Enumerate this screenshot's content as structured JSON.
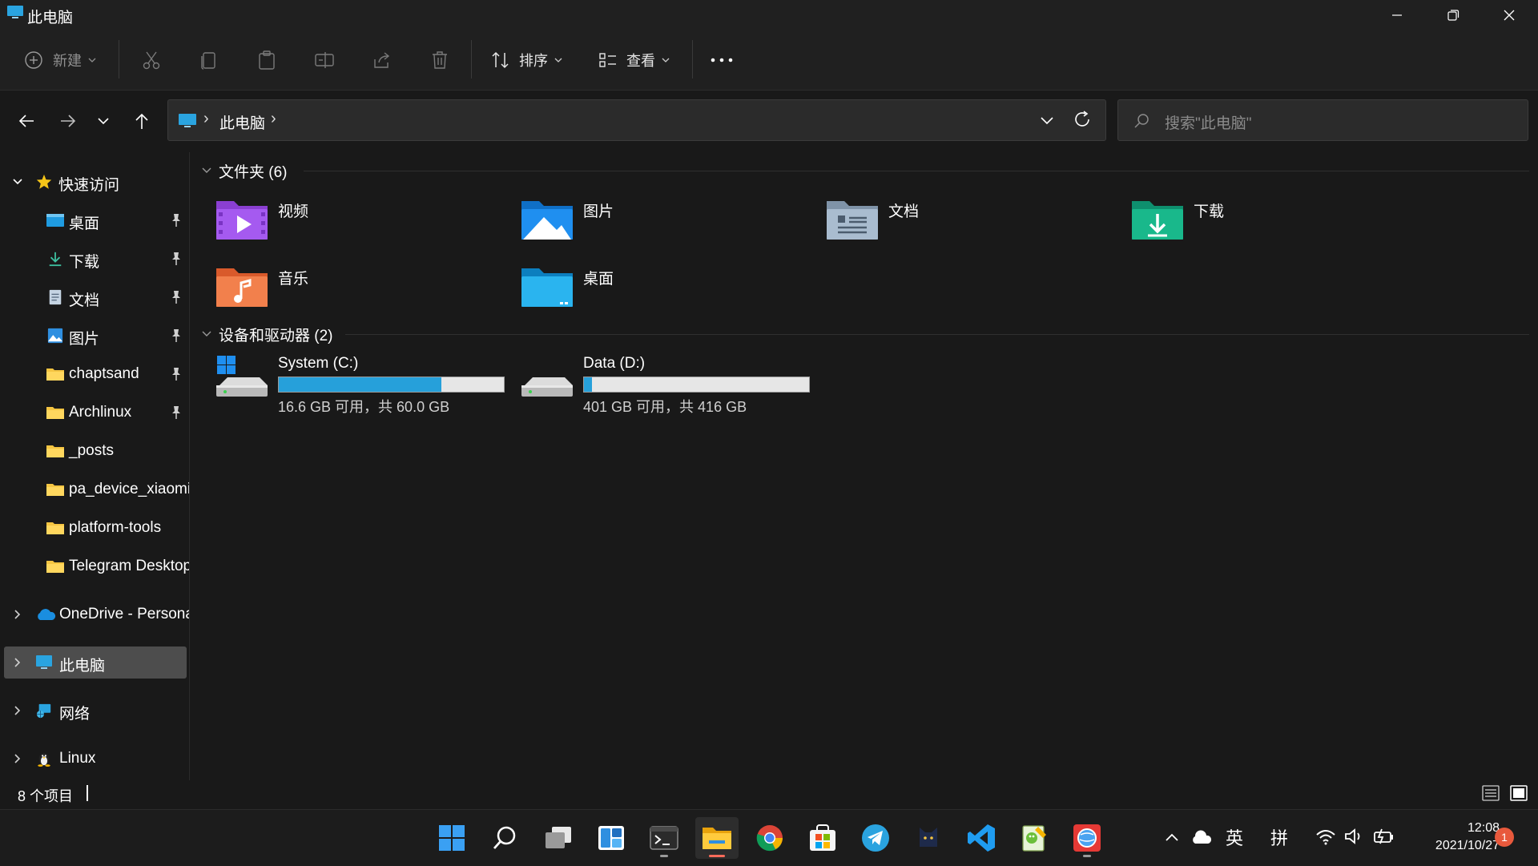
{
  "window": {
    "title": "此电脑"
  },
  "commandbar": {
    "new_label": "新建",
    "sort_label": "排序",
    "view_label": "查看"
  },
  "address": {
    "crumb": "此电脑",
    "search_placeholder": "搜索\"此电脑\""
  },
  "sidebar": {
    "quick_access": "快速访问",
    "items": [
      {
        "label": "桌面",
        "icon": "desktop-folder-icon",
        "pinned": true
      },
      {
        "label": "下载",
        "icon": "download-icon",
        "pinned": true
      },
      {
        "label": "文档",
        "icon": "document-icon",
        "pinned": true
      },
      {
        "label": "图片",
        "icon": "pictures-icon",
        "pinned": true
      },
      {
        "label": "chaptsand",
        "icon": "folder-icon",
        "pinned": true
      },
      {
        "label": "Archlinux",
        "icon": "folder-icon",
        "pinned": true
      },
      {
        "label": "_posts",
        "icon": "folder-icon",
        "pinned": false
      },
      {
        "label": "pa_device_xiaomi",
        "icon": "folder-icon",
        "pinned": false
      },
      {
        "label": "platform-tools",
        "icon": "folder-icon",
        "pinned": false
      },
      {
        "label": "Telegram Desktop",
        "icon": "folder-icon",
        "pinned": false
      }
    ],
    "onedrive": "OneDrive - Personal",
    "this_pc": "此电脑",
    "network": "网络",
    "linux": "Linux"
  },
  "main": {
    "folders_header": "文件夹 (6)",
    "folders": [
      {
        "label": "视频",
        "icon": "videos-folder-icon"
      },
      {
        "label": "图片",
        "icon": "pictures-folder-icon"
      },
      {
        "label": "文档",
        "icon": "documents-folder-icon"
      },
      {
        "label": "下载",
        "icon": "downloads-folder-icon"
      },
      {
        "label": "音乐",
        "icon": "music-folder-icon"
      },
      {
        "label": "桌面",
        "icon": "desktop-folder-icon"
      }
    ],
    "drives_header": "设备和驱动器 (2)",
    "drives": [
      {
        "name": "System (C:)",
        "free": "16.6 GB 可用，共 60.0 GB",
        "used_fraction": 0.723
      },
      {
        "name": "Data (D:)",
        "free": "401 GB 可用，共 416 GB",
        "used_fraction": 0.036
      }
    ]
  },
  "status": {
    "item_count": "8 个项目"
  },
  "taskbar": {
    "ime_lang": "英",
    "ime_mode": "拼",
    "time": "12:08",
    "date": "2021/10/27",
    "notifications": "1"
  },
  "colors": {
    "accent": "#26a0da",
    "folder": "#f5c542",
    "notification": "#e8593c"
  }
}
